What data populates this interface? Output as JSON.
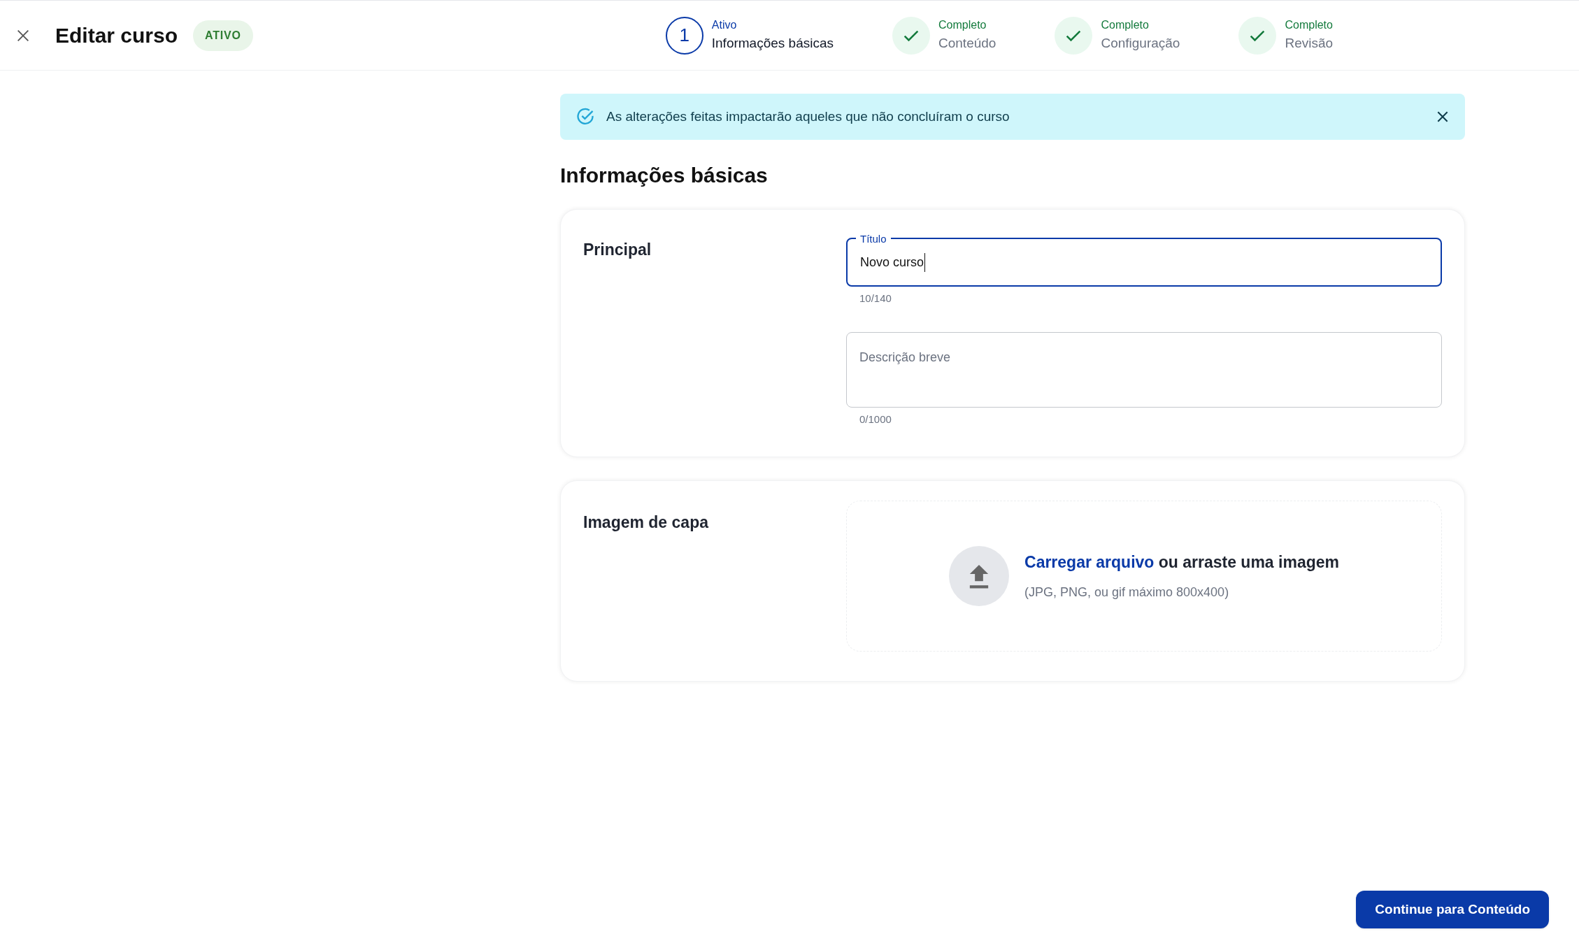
{
  "header": {
    "title": "Editar curso",
    "status_badge": "ATIVO"
  },
  "steps": [
    {
      "number": "1",
      "status": "Ativo",
      "label": "Informações básicas",
      "kind": "active"
    },
    {
      "status": "Completo",
      "label": "Conteúdo",
      "kind": "complete"
    },
    {
      "status": "Completo",
      "label": "Configuração",
      "kind": "complete"
    },
    {
      "status": "Completo",
      "label": "Revisão",
      "kind": "complete"
    }
  ],
  "alert": {
    "message": "As alterações feitas impactarão aqueles que não concluíram o curso"
  },
  "section_title": "Informações básicas",
  "main_card": {
    "title": "Principal",
    "fields": [
      {
        "kind": "input",
        "label": "Título",
        "value": "Novo curso",
        "counter": "10/140",
        "focused": true
      },
      {
        "kind": "textarea",
        "placeholder": "Descrição breve",
        "counter": "0/1000",
        "focused": false
      }
    ]
  },
  "cover_card": {
    "title": "Imagem de capa",
    "upload_link": "Carregar arquivo",
    "upload_rest": "ou arraste uma imagem",
    "hint": "(JPG, PNG, ou gif máximo 800x400)"
  },
  "continue_button": "Continue para Conteúdo"
}
